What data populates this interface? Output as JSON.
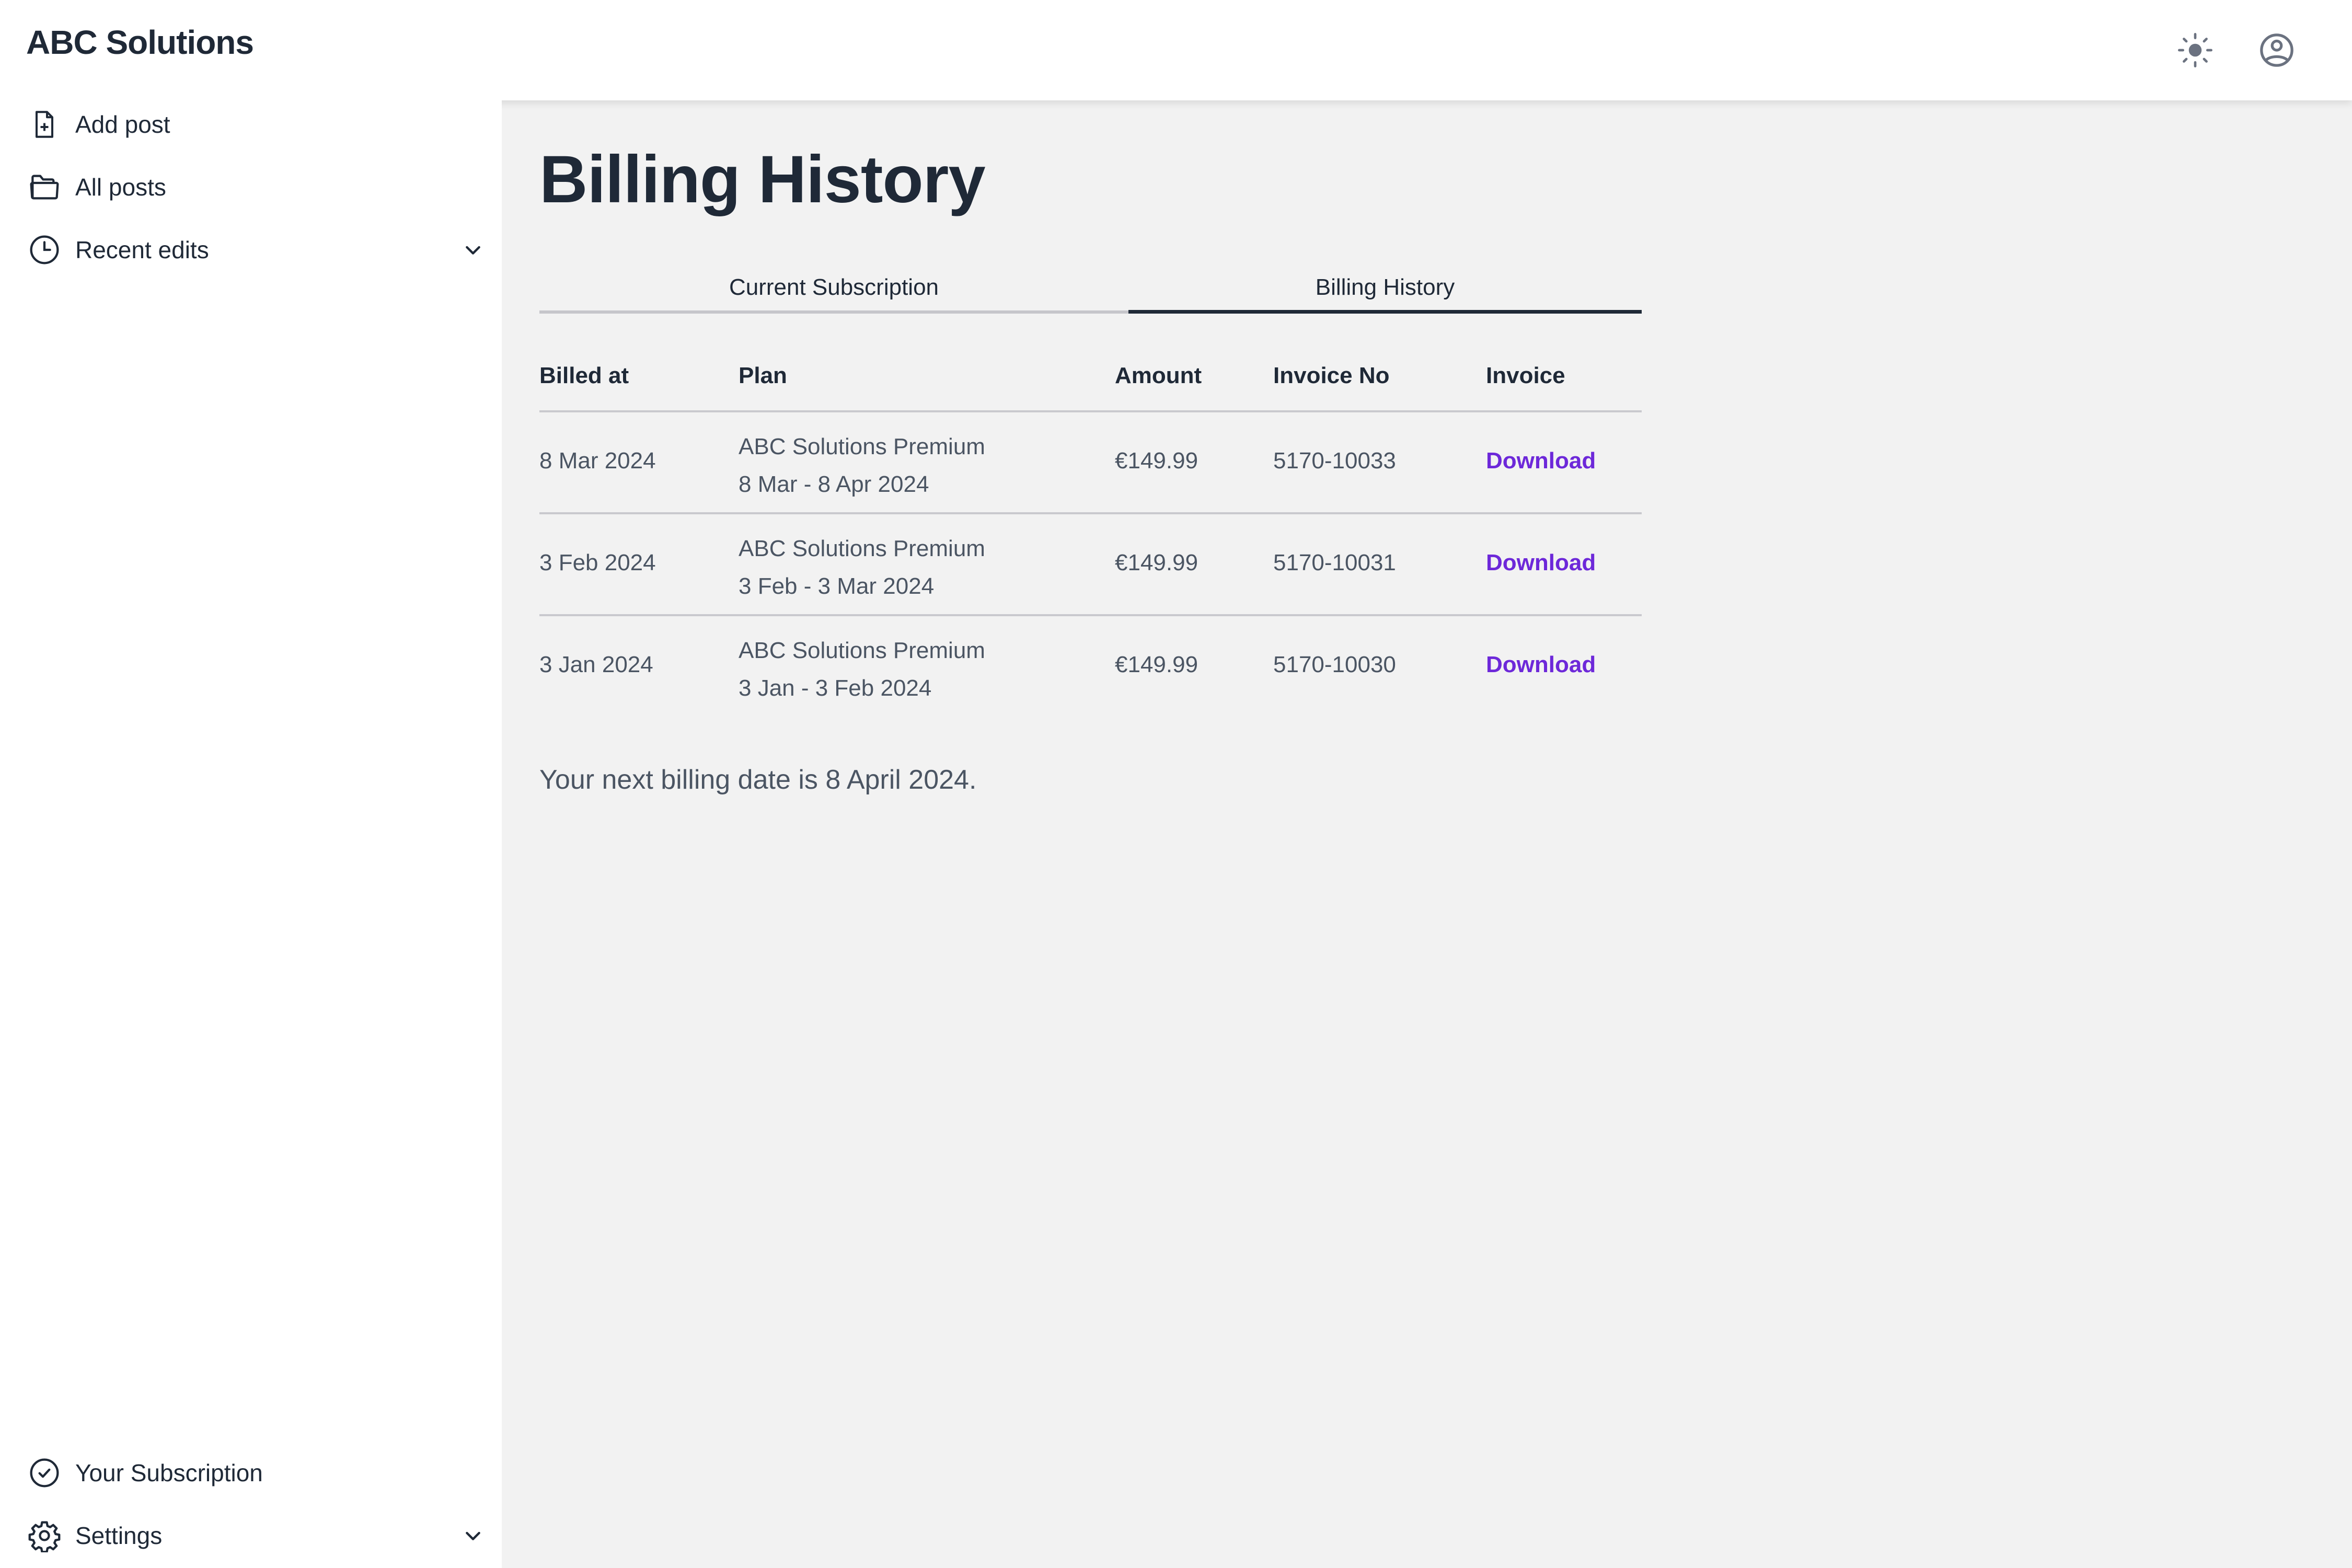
{
  "app": {
    "brand": "ABC Solutions"
  },
  "header": {
    "theme_toggle_icon": "sun-icon",
    "account_icon": "user-circle-icon"
  },
  "sidebar": {
    "items": [
      {
        "label": "Add post",
        "icon": "file-plus-icon"
      },
      {
        "label": "All posts",
        "icon": "folder-icon"
      },
      {
        "label": "Recent edits",
        "icon": "clock-icon",
        "expandable": true
      }
    ],
    "bottom_items": [
      {
        "label": "Your Subscription",
        "icon": "badge-check-icon"
      },
      {
        "label": "Settings",
        "icon": "gear-icon",
        "expandable": true
      }
    ]
  },
  "main": {
    "title": "Billing History",
    "tabs": [
      {
        "label": "Current Subscription",
        "active": false
      },
      {
        "label": "Billing History",
        "active": true
      }
    ],
    "table": {
      "columns": [
        "Billed at",
        "Plan",
        "Amount",
        "Invoice No",
        "Invoice"
      ],
      "rows": [
        {
          "billed_at": "8 Mar 2024",
          "plan_name": "ABC Solutions Premium",
          "plan_period": "8 Mar - 8 Apr 2024",
          "amount": "€149.99",
          "invoice_no": "5170-10033",
          "invoice_link": "Download"
        },
        {
          "billed_at": "3 Feb 2024",
          "plan_name": "ABC Solutions Premium",
          "plan_period": "3 Feb - 3 Mar 2024",
          "amount": "€149.99",
          "invoice_no": "5170-10031",
          "invoice_link": "Download"
        },
        {
          "billed_at": "3 Jan 2024",
          "plan_name": "ABC Solutions Premium",
          "plan_period": "3 Jan - 3 Feb 2024",
          "amount": "€149.99",
          "invoice_no": "5170-10030",
          "invoice_link": "Download"
        }
      ]
    },
    "next_billing": "Your next billing date is 8 April 2024."
  },
  "colors": {
    "accent_link": "#6d28d9",
    "text_primary": "#1f2937",
    "text_secondary": "#4b5563",
    "icon_gray": "#6b7280",
    "background": "#f2f2f2"
  }
}
